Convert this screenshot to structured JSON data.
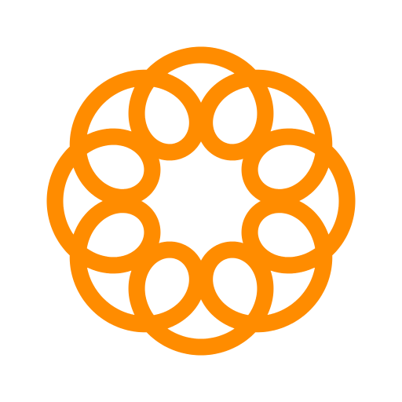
{
  "logo": {
    "icon": "orange-looped-flower-icon",
    "color": "#FF8C00",
    "background": "#FFFFFF",
    "petal_count": 8
  }
}
